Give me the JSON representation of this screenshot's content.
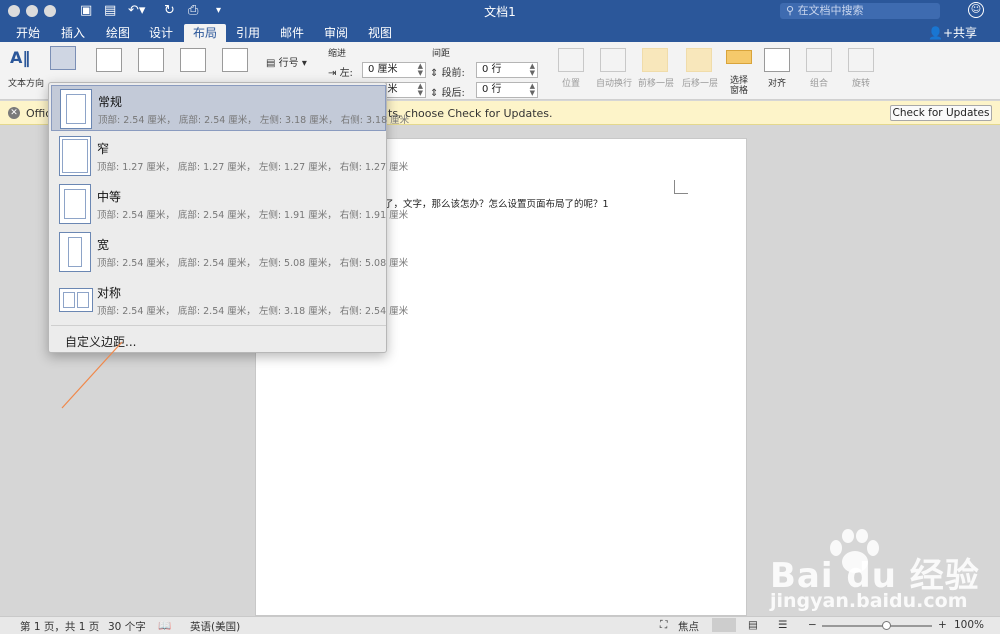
{
  "window": {
    "title": "文档1",
    "search_placeholder": "在文档中搜索",
    "share_label": "共享"
  },
  "tabs": [
    "开始",
    "插入",
    "绘图",
    "设计",
    "布局",
    "引用",
    "邮件",
    "审阅",
    "视图"
  ],
  "active_tab": "布局",
  "ribbon": {
    "text_direction": "文本方向",
    "line_numbers": "行号",
    "indent_title": "缩进",
    "spacing_title": "间距",
    "indent_left_label": "左:",
    "indent_left_value": "0 厘米",
    "indent_right_value": "0 厘米",
    "spacing_before_label": "段前:",
    "spacing_before_value": "0 行",
    "spacing_after_label": "段后:",
    "spacing_after_value": "0 行",
    "arrange": [
      "位置",
      "自动换行",
      "前移一层",
      "后移一层"
    ],
    "selection_pane": [
      "选择",
      "窗格"
    ],
    "align": "对齐",
    "group": "组合",
    "rotate": "旋转"
  },
  "infobar": {
    "text_left": "Offic",
    "text_right": "ts, choose Check for Updates.",
    "button": "Check for Updates"
  },
  "document": {
    "line_text": "了，文字，那么该怎办？怎么设置页面布局了的呢？1"
  },
  "margins_menu": {
    "items": [
      {
        "name": "常规",
        "desc": "顶部: 2.54 厘米， 底部: 2.54 厘米， 左侧: 3.18 厘米， 右侧: 3.18 厘米",
        "selected": true
      },
      {
        "name": "窄",
        "desc": "顶部: 1.27 厘米， 底部: 1.27 厘米， 左侧: 1.27 厘米， 右侧: 1.27 厘米",
        "selected": false
      },
      {
        "name": "中等",
        "desc": "顶部: 2.54 厘米， 底部: 2.54 厘米， 左侧: 1.91 厘米， 右侧: 1.91 厘米",
        "selected": false
      },
      {
        "name": "宽",
        "desc": "顶部: 2.54 厘米， 底部: 2.54 厘米， 左侧: 5.08 厘米， 右侧: 5.08 厘米",
        "selected": false
      },
      {
        "name": "对称",
        "desc": "顶部: 2.54 厘米， 底部: 2.54 厘米， 左侧: 3.18 厘米， 右侧: 2.54 厘米",
        "selected": false
      }
    ],
    "custom": "自定义边距..."
  },
  "statusbar": {
    "page": "第 1 页，共 1 页",
    "words": "30 个字",
    "language": "英语(美国)",
    "focus": "焦点",
    "zoom": "100%"
  },
  "watermark": {
    "logo": "Bai du 经验",
    "url": "jingyan.baidu.com"
  },
  "colors": {
    "brand": "#2b579a",
    "infobar": "#fdf4c9",
    "selected_item": "#c3cad8"
  }
}
